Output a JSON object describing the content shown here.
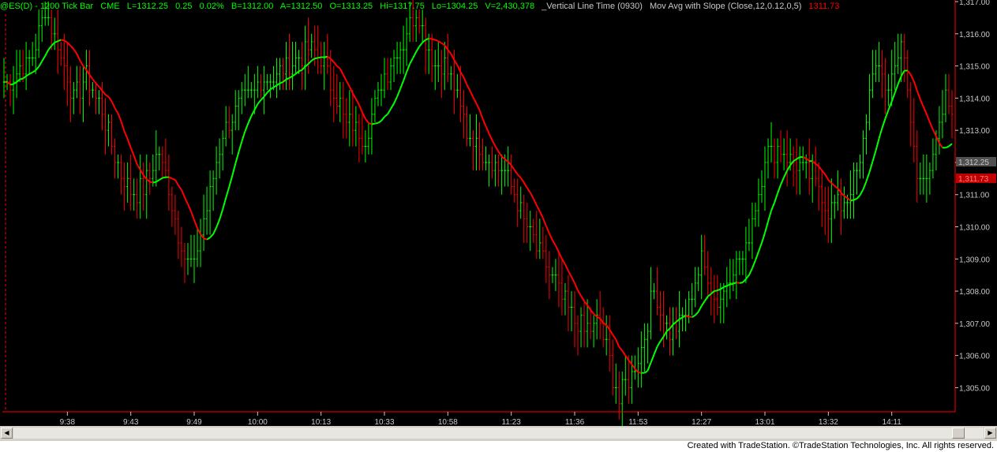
{
  "header": {
    "symbol": "@ES(D) - 1200 Tick Bar",
    "exchange": "CME",
    "last": "L=1312.25",
    "change": "0.25",
    "change_pct": "0.02%",
    "bid": "B=1312.00",
    "ask": "A=1312.50",
    "open": "O=1313.25",
    "high": "Hi=1317.75",
    "low": "Lo=1304.25",
    "volume": "V=2,430,378",
    "study1": "_Vertical Line Time (0930)",
    "study2": "Mov Avg with Slope (Close,12,0.12,0,5)",
    "study2_value": "1311.73"
  },
  "colors": {
    "up": "#00ff00",
    "down": "#ff0000",
    "background": "#000000",
    "axis": "#ff0000",
    "text": "#c8c8c8"
  },
  "price_labels": {
    "last": "1,312.25",
    "ma": "1,311.73"
  },
  "footer": {
    "credit": "Created with TradeStation. ©TradeStation Technologies, Inc. All rights reserved."
  },
  "chart_data": {
    "type": "line",
    "title": "",
    "xlabel": "",
    "ylabel": "",
    "ylim": [
      1304.25,
      1317.05
    ],
    "y_ticks": [
      "1,305.00",
      "1,306.00",
      "1,307.00",
      "1,308.00",
      "1,309.00",
      "1,310.00",
      "1,311.00",
      "1,312.00",
      "1,313.00",
      "1,314.00",
      "1,315.00",
      "1,316.00",
      "1,317.00"
    ],
    "y_tick_values": [
      1305,
      1306,
      1307,
      1308,
      1309,
      1310,
      1311,
      1312,
      1313,
      1314,
      1315,
      1316,
      1317
    ],
    "bar_count": 300,
    "x_tick_labels": [
      {
        "label": "9:38",
        "bar": 20
      },
      {
        "label": "9:43",
        "bar": 40
      },
      {
        "label": "9:49",
        "bar": 60
      },
      {
        "label": "10:00",
        "bar": 80
      },
      {
        "label": "10:13",
        "bar": 100
      },
      {
        "label": "10:33",
        "bar": 120
      },
      {
        "label": "10:58",
        "bar": 140
      },
      {
        "label": "11:23",
        "bar": 160
      },
      {
        "label": "11:36",
        "bar": 180
      },
      {
        "label": "11:53",
        "bar": 200
      },
      {
        "label": "12:27",
        "bar": 220
      },
      {
        "label": "13:01",
        "bar": 240
      },
      {
        "label": "13:32",
        "bar": 260
      },
      {
        "label": "14:11",
        "bar": 280
      }
    ],
    "price_path": [
      [
        0,
        1314.5
      ],
      [
        3,
        1314.7
      ],
      [
        9,
        1315.3
      ],
      [
        13,
        1316.9
      ],
      [
        18,
        1315.3
      ],
      [
        22,
        1314.0
      ],
      [
        26,
        1314.7
      ],
      [
        31,
        1313.6
      ],
      [
        35,
        1312.2
      ],
      [
        40,
        1311.0
      ],
      [
        44,
        1311.2
      ],
      [
        49,
        1312.3
      ],
      [
        53,
        1310.8
      ],
      [
        57,
        1309.0
      ],
      [
        60,
        1308.8
      ],
      [
        64,
        1310.6
      ],
      [
        69,
        1313.0
      ],
      [
        74,
        1313.7
      ],
      [
        82,
        1314.6
      ],
      [
        86,
        1314.7
      ],
      [
        91,
        1315.2
      ],
      [
        98,
        1315.5
      ],
      [
        102,
        1314.8
      ],
      [
        108,
        1313.2
      ],
      [
        114,
        1312.8
      ],
      [
        120,
        1314.7
      ],
      [
        126,
        1315.8
      ],
      [
        130,
        1316.8
      ],
      [
        135,
        1315.2
      ],
      [
        140,
        1314.9
      ],
      [
        146,
        1313.0
      ],
      [
        152,
        1312.2
      ],
      [
        158,
        1311.7
      ],
      [
        164,
        1310.2
      ],
      [
        170,
        1309.0
      ],
      [
        176,
        1307.8
      ],
      [
        182,
        1306.8
      ],
      [
        188,
        1307.0
      ],
      [
        194,
        1304.6
      ],
      [
        200,
        1305.9
      ],
      [
        205,
        1308.0
      ],
      [
        210,
        1306.6
      ],
      [
        215,
        1307.2
      ],
      [
        220,
        1309.0
      ],
      [
        225,
        1307.6
      ],
      [
        229,
        1308.6
      ],
      [
        234,
        1309.2
      ],
      [
        240,
        1312.2
      ],
      [
        245,
        1312.5
      ],
      [
        250,
        1312.0
      ],
      [
        255,
        1311.6
      ],
      [
        260,
        1310.6
      ],
      [
        265,
        1310.8
      ],
      [
        270,
        1311.8
      ],
      [
        274,
        1315.0
      ],
      [
        279,
        1314.3
      ],
      [
        283,
        1315.8
      ],
      [
        288,
        1311.5
      ],
      [
        293,
        1312.0
      ],
      [
        297,
        1313.9
      ],
      [
        300,
        1313.8
      ]
    ],
    "series": [
      {
        "values_from": "price_path"
      },
      {
        "moving_average_length": 12
      }
    ]
  }
}
